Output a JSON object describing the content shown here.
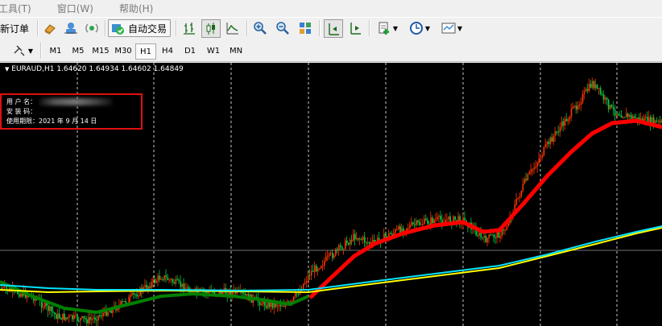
{
  "menu": [
    {
      "label": "工具(T)"
    },
    {
      "label": "窗口(W)"
    },
    {
      "label": "帮助(H)"
    }
  ],
  "toolbar": {
    "new_order_label": "新订单",
    "auto_trade_label": "自动交易",
    "icons": [
      "new-order-icon",
      "market-watch-icon",
      "navigator-icon",
      "signal-icon",
      "auto-trade-icon",
      "bar-chart-icon",
      "candlestick-icon",
      "line-chart-icon",
      "zoom-in-icon",
      "zoom-out-icon",
      "tile-windows-icon",
      "chart-shift-icon",
      "autoscroll-icon",
      "indicators-icon",
      "periods-clock-icon",
      "templates-icon"
    ]
  },
  "timeframes": [
    "M1",
    "M5",
    "M15",
    "M30",
    "H1",
    "H4",
    "D1",
    "W1",
    "MN"
  ],
  "active_timeframe": "H1",
  "chart": {
    "title": "EURAUD,H1  1.64620 1.64934 1.64602 1.64849",
    "info_user_label": "用 户 名：",
    "info_install_label": "安 装 码：",
    "info_expiry": "使用期限：2021 年 9 月 14 日",
    "colors": {
      "bull": "#ff3300",
      "bear": "#00cc44",
      "ma_fast": "#ff0000",
      "ma_mid": "#00e5ff",
      "ma_slow": "#ffff00",
      "ma_green": "#008000",
      "grid": "#c8c8c8"
    },
    "candle_count": 410
  }
}
